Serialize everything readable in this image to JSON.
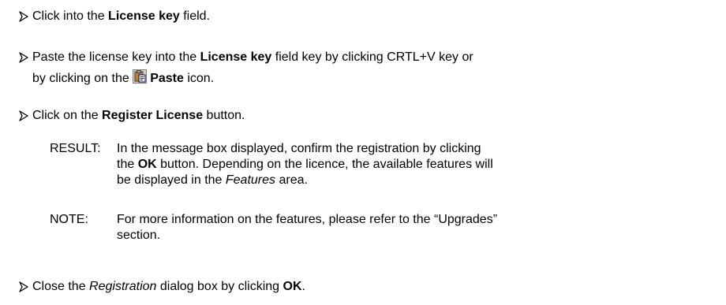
{
  "steps": [
    {
      "pre": "Click into the ",
      "bold": "License key",
      "post": " field."
    },
    {
      "line1_pre": "Paste the license key into the ",
      "line1_bold": "License key",
      "line1_post": " field key by clicking CRTL+V key or",
      "line2_pre": "by clicking on the ",
      "icon": "paste-icon",
      "line2_bold": "Paste",
      "line2_post": " icon."
    },
    {
      "pre": "Click on the ",
      "bold": "Register License",
      "post": " button."
    },
    {
      "pre": "Close the ",
      "italic": "Registration",
      "mid": " dialog box by clicking ",
      "bold": "OK",
      "post": "."
    }
  ],
  "result": {
    "label": "RESULT:",
    "line1": "In the message box displayed, confirm the registration by clicking",
    "line2_pre": "the ",
    "line2_bold": "OK",
    "line2_post": " button. Depending on the licence, the available features will",
    "line3_pre": "be displayed in the ",
    "line3_italic": "Features",
    "line3_post": " area."
  },
  "note": {
    "label": "NOTE:",
    "line1": "For more information on the features, please refer to the “Upgrades”",
    "line2": "section."
  }
}
